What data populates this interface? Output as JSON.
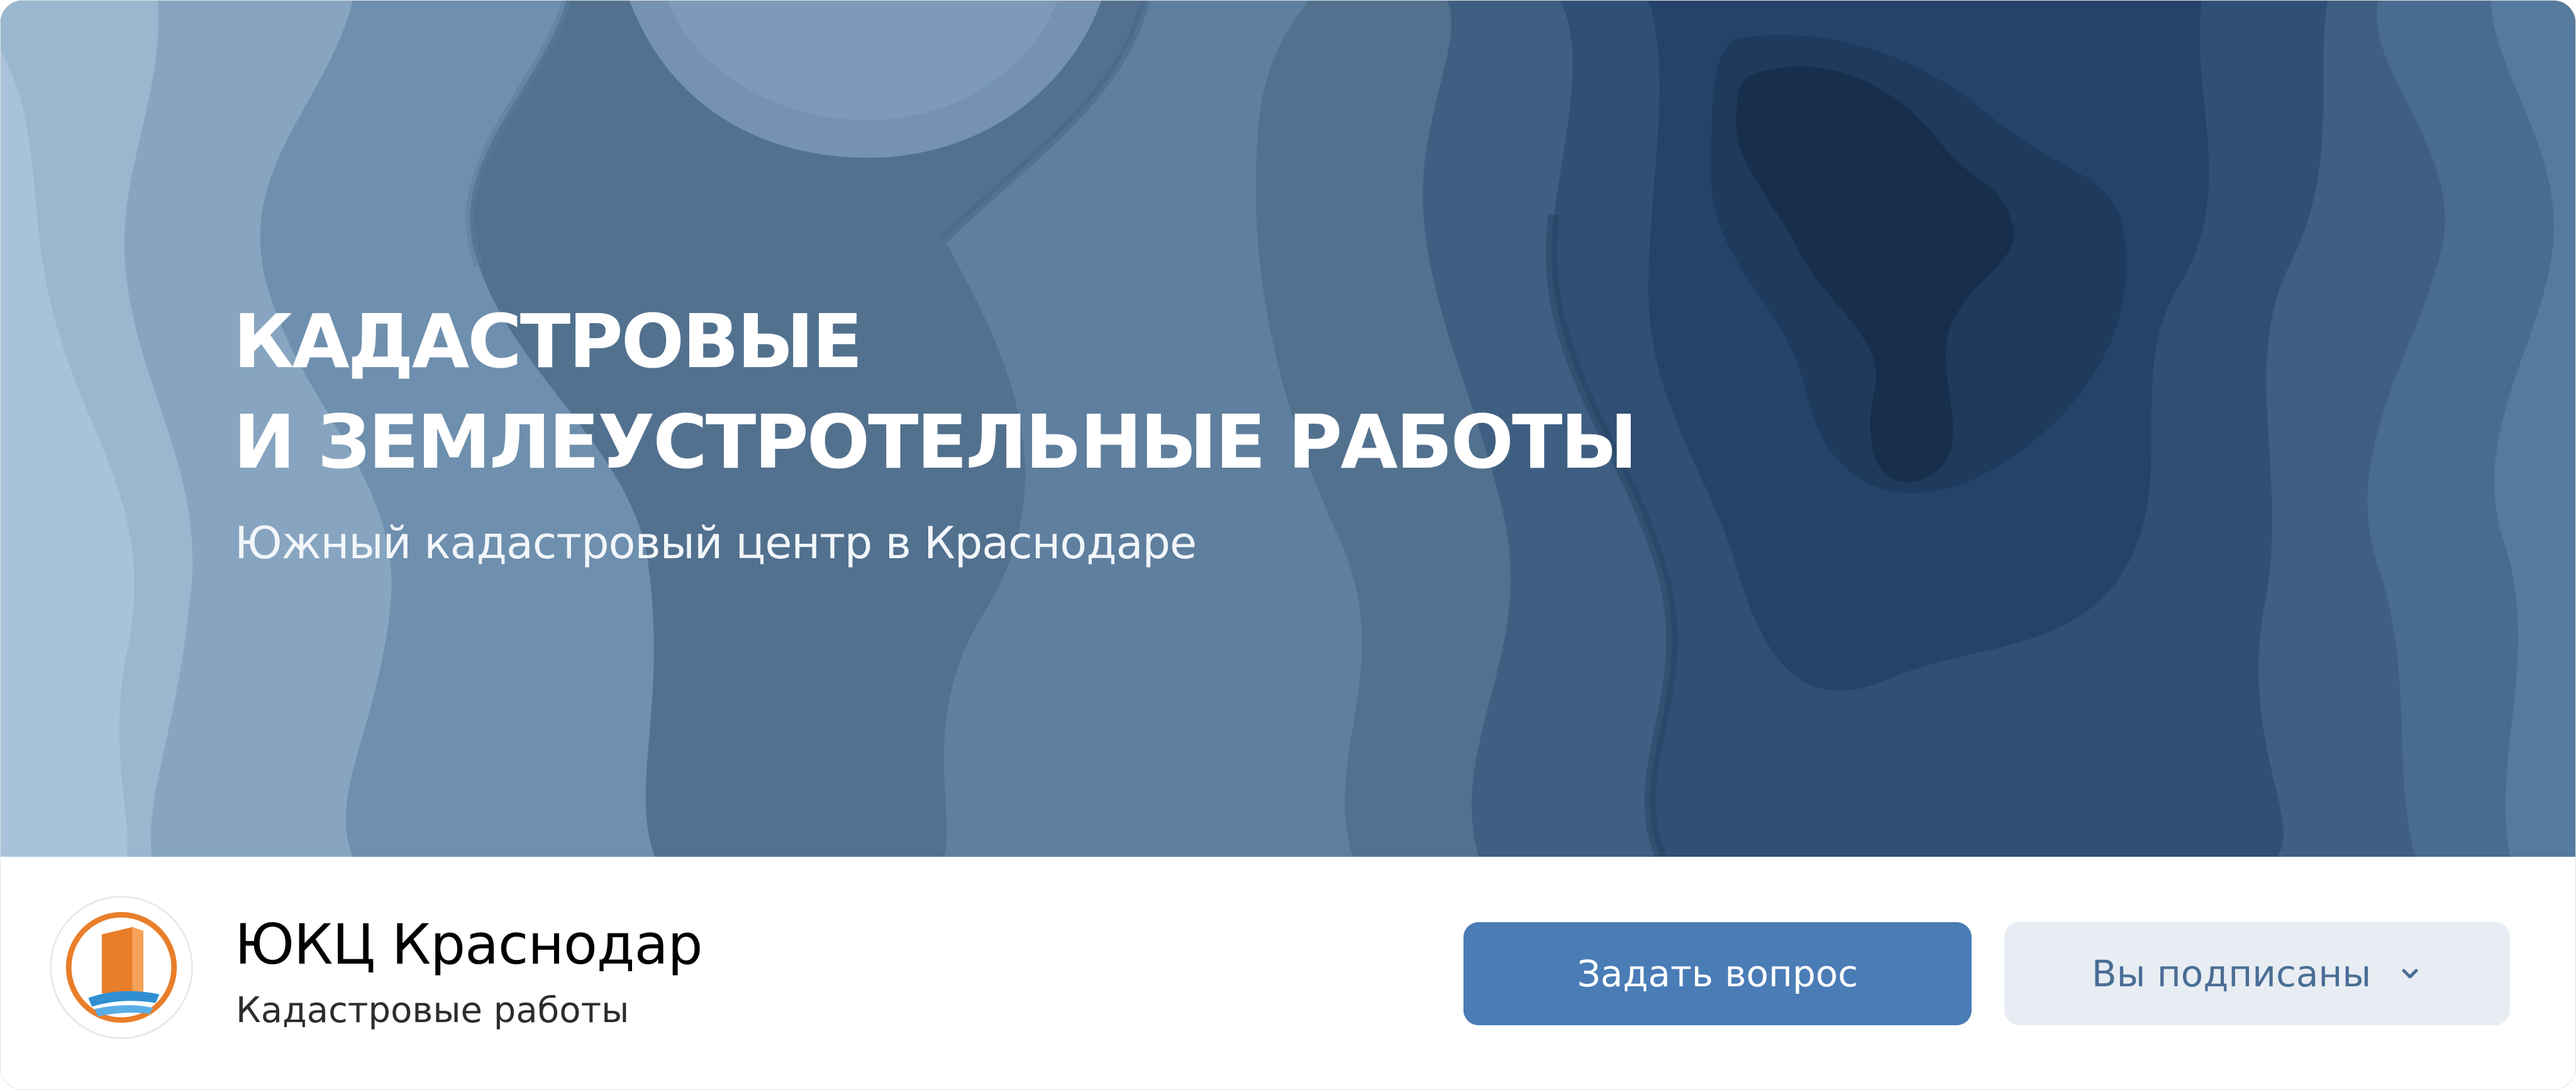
{
  "cover": {
    "title_line1": "КАДАСТРОВЫЕ",
    "title_line2": "И ЗЕМЛЕУСТРОТЕЛЬНЫЕ РАБОТЫ",
    "subtitle": "Южный кадастровый центр в Краснодаре"
  },
  "group": {
    "name": "ЮКЦ Краснодар",
    "category": "Кадастровые работы"
  },
  "actions": {
    "ask_label": "Задать вопрос",
    "subscribed_label": "Вы подписаны"
  },
  "icons": {
    "avatar_logo": "door-logo-icon",
    "subscribed_menu": "chevron-down-icon"
  },
  "colors": {
    "primary_button": "#4a7cb6",
    "secondary_button": "#e8edf3",
    "secondary_text": "#4a6d95",
    "logo_orange": "#e97e2a",
    "logo_blue": "#2f8fd1"
  }
}
